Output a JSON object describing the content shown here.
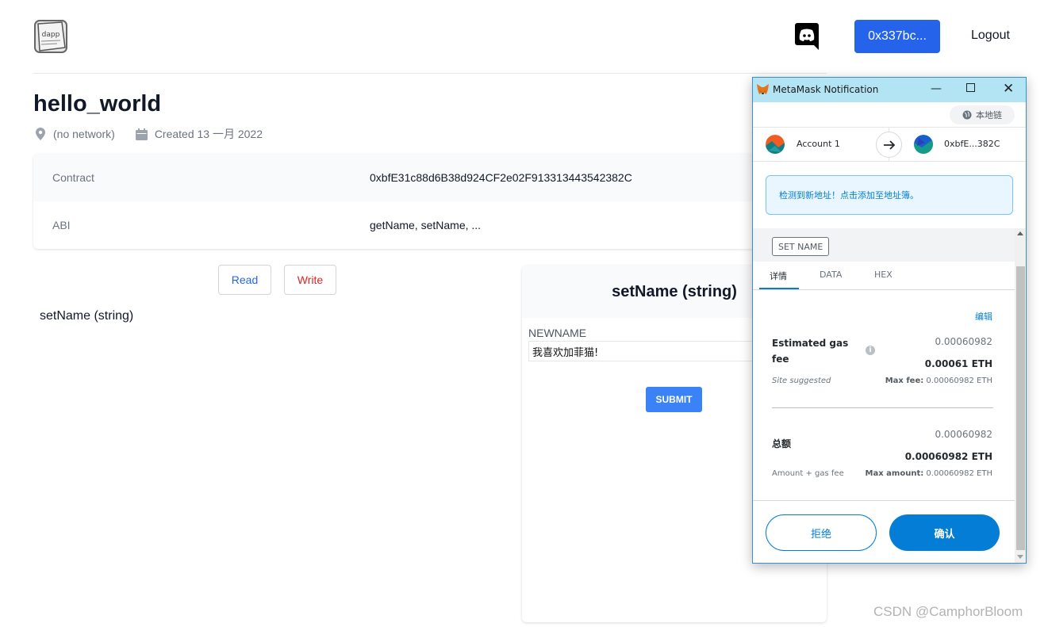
{
  "header": {
    "wallet_address": "0x337bc...",
    "logout_label": "Logout",
    "logo_text": "dapp"
  },
  "contract": {
    "title": "hello_world",
    "network": "(no network)",
    "created": "Created 13 一月 2022",
    "rows": [
      {
        "label": "Contract",
        "value": "0xbfE31c88d6B38d924CF2e02F913313443542382C"
      },
      {
        "label": "ABI",
        "value": "getName, setName, ..."
      }
    ]
  },
  "tabs": {
    "read": "Read",
    "write": "Write"
  },
  "function": {
    "list_label": "setName (string)",
    "panel_title": "setName (string)",
    "field_label": "NEWNAME",
    "field_value": "我喜欢加菲猫!",
    "submit_label": "SUBMIT"
  },
  "watermark": "CSDN @CamphorBloom",
  "metamask": {
    "window_title": "MetaMask Notification",
    "network": "本地链",
    "from_account": "Account 1",
    "to_account": "0xbfE...382C",
    "notice": "检测到新地址！点击添加至地址簿。",
    "method": "SET NAME",
    "tabs": [
      "详情",
      "DATA",
      "HEX"
    ],
    "edit_label": "编辑",
    "gas": {
      "label_line1": "Estimated gas",
      "label_line2": "fee",
      "value": "0.00060982",
      "value_eth": "0.00061 ETH",
      "site_suggested": "Site suggested",
      "max_fee_label": "Max fee:",
      "max_fee_value": "0.00060982 ETH"
    },
    "total": {
      "label": "总额",
      "value": "0.00060982",
      "value_eth": "0.00060982 ETH",
      "amount_gas": "Amount + gas fee",
      "max_amount_label": "Max amount:",
      "max_amount_value": "0.00060982 ETH"
    },
    "reject_label": "拒绝",
    "confirm_label": "确认"
  },
  "colors": {
    "primary": "#2563eb",
    "metamask_blue": "#037dd6",
    "write_red": "#dc2626",
    "titlebar": "#b3e4f3"
  }
}
